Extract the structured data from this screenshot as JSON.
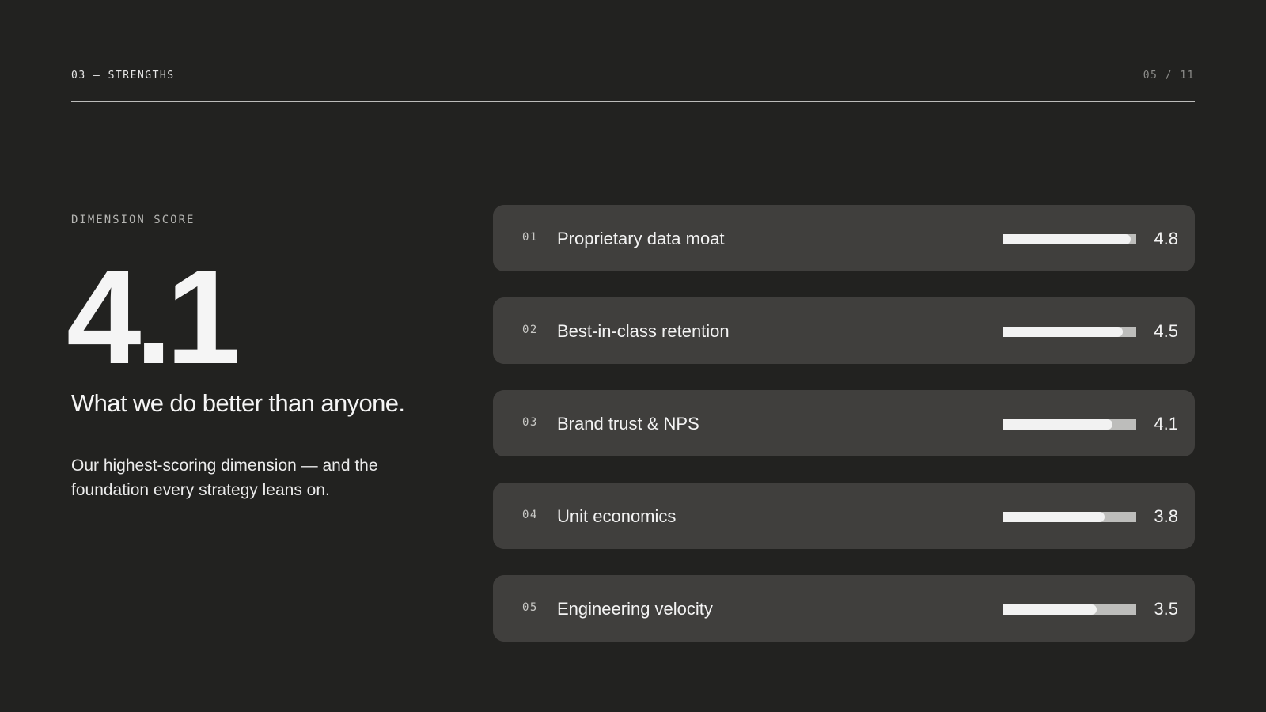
{
  "header": {
    "section": "03 — STRENGTHS",
    "page": "05 / 11"
  },
  "summary": {
    "label": "DIMENSION SCORE",
    "score": "4.1",
    "headline": "What we do better than anyone.",
    "description": "Our highest-scoring dimension — and the foundation every strategy leans on."
  },
  "scale_max": 5,
  "strengths": [
    {
      "num": "01",
      "label": "Proprietary data moat",
      "value": "4.8",
      "score": 4.8
    },
    {
      "num": "02",
      "label": "Best-in-class retention",
      "value": "4.5",
      "score": 4.5
    },
    {
      "num": "03",
      "label": "Brand trust & NPS",
      "value": "4.1",
      "score": 4.1
    },
    {
      "num": "04",
      "label": "Unit economics",
      "value": "3.8",
      "score": 3.8
    },
    {
      "num": "05",
      "label": "Engineering velocity",
      "value": "3.5",
      "score": 3.5
    }
  ],
  "colors": {
    "background": "#222220",
    "card": "#403f3d",
    "bar_fill": "#f2f2f2",
    "bar_track": "#bdbdbb"
  }
}
